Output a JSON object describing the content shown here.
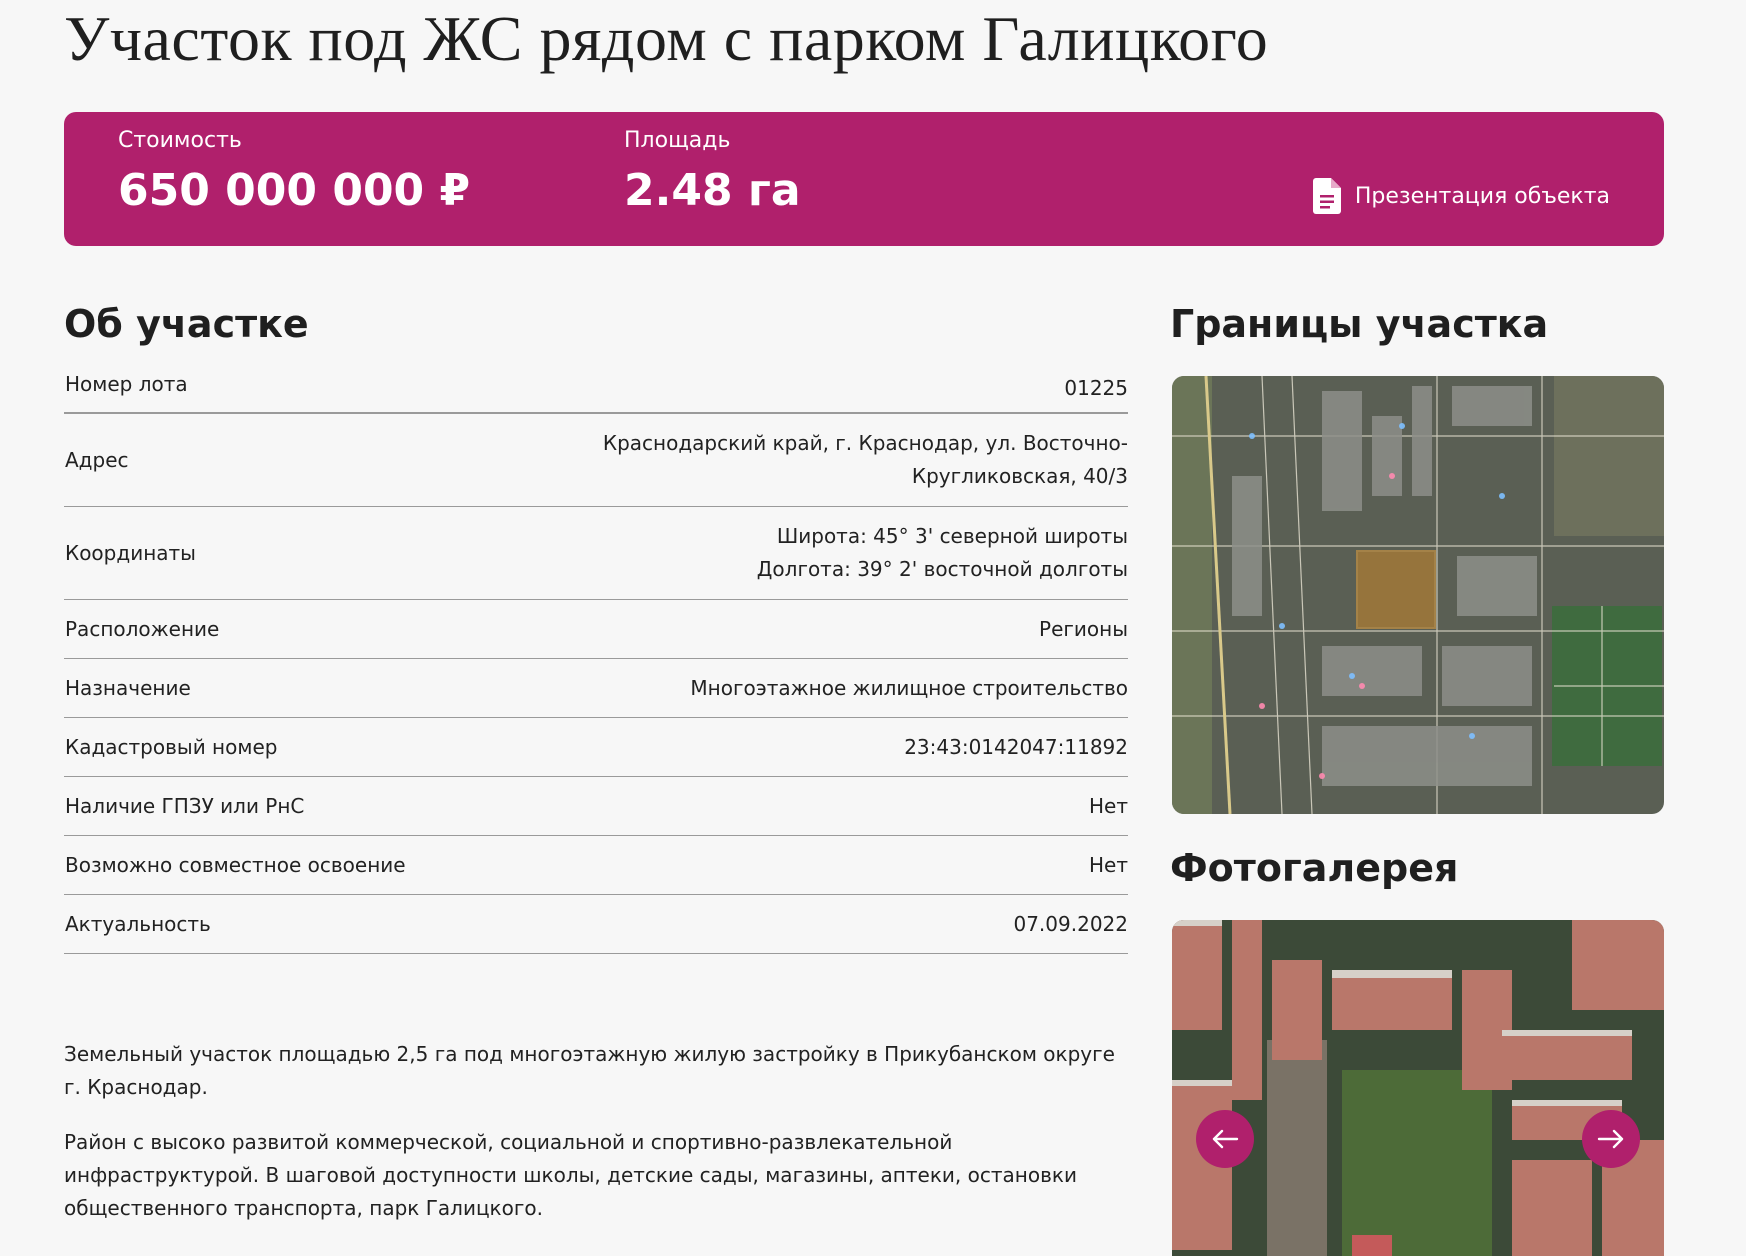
{
  "page": {
    "title": "Участок под ЖС рядом с парком Галицкого"
  },
  "banner": {
    "cost_label": "Стоимость",
    "cost_value": "650 000 000 ₽",
    "area_label": "Площадь",
    "area_value": "2.48 га",
    "presentation_label": "Презентация объекта",
    "presentation_icon": "document-icon",
    "color": "#b0206c"
  },
  "about": {
    "heading": "Об участке",
    "rows": [
      {
        "key": "Номер лота",
        "value": "01225"
      },
      {
        "key": "Адрес",
        "value_line1": "Краснодарский край, г. Краснодар, ул. Восточно-",
        "value_line2": "Кругликовская, 40/3"
      },
      {
        "key": "Координаты",
        "value_line1": "Широта: 45° 3' северной широты",
        "value_line2": "Долгота: 39° 2' восточной долготы"
      },
      {
        "key": "Расположение",
        "value": "Регионы"
      },
      {
        "key": "Назначение",
        "value": "Многоэтажное жилищное строительство"
      },
      {
        "key": "Кадастровый номер",
        "value": "23:43:0142047:11892"
      },
      {
        "key": "Наличие ГПЗУ или РнС",
        "value": "Нет"
      },
      {
        "key": "Возможно совместное освоение",
        "value": "Нет"
      },
      {
        "key": "Актуальность",
        "value": "07.09.2022"
      }
    ]
  },
  "description": {
    "p1": "Земельный участок площадью 2,5 га под многоэтажную жилую застройку в Прикубанском округе г. Краснодар.",
    "p2": "Район с высоко развитой коммерческой, социальной и спортивно-развлекательной инфраструктурой. В шаговой доступности школы, детские сады, магазины, аптеки, остановки общественного транспорта, парк Галицкого."
  },
  "boundaries": {
    "heading": "Границы участка"
  },
  "gallery": {
    "heading": "Фотогалерея",
    "prev_icon": "arrow-left-icon",
    "next_icon": "arrow-right-icon"
  }
}
